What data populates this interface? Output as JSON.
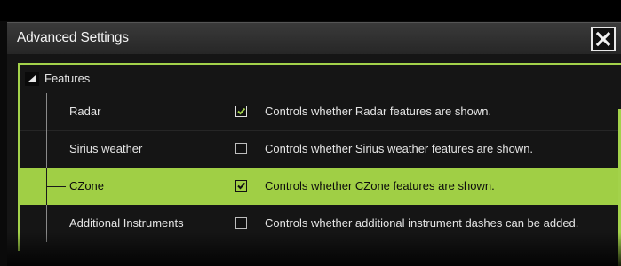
{
  "window": {
    "title": "Advanced Settings"
  },
  "close_button": {
    "icon": "close-icon"
  },
  "tree": {
    "header": {
      "label": "Features",
      "expanded": true,
      "icon": "collapse-triangle-icon"
    },
    "items": [
      {
        "label": "Radar",
        "checked": true,
        "selected": false,
        "description": "Controls whether Radar features are shown."
      },
      {
        "label": "Sirius weather",
        "checked": false,
        "selected": false,
        "description": "Controls whether Sirius weather features are shown."
      },
      {
        "label": "CZone",
        "checked": true,
        "selected": true,
        "description": "Controls whether CZone features are shown."
      },
      {
        "label": "Additional Instruments",
        "checked": false,
        "selected": false,
        "description": "Controls whether additional instrument dashes can be added."
      }
    ]
  },
  "colors": {
    "accent": "#a3d24a",
    "selected_row": "#a0cf45",
    "background": "#151515",
    "titlebar": "#2e2e2e"
  }
}
